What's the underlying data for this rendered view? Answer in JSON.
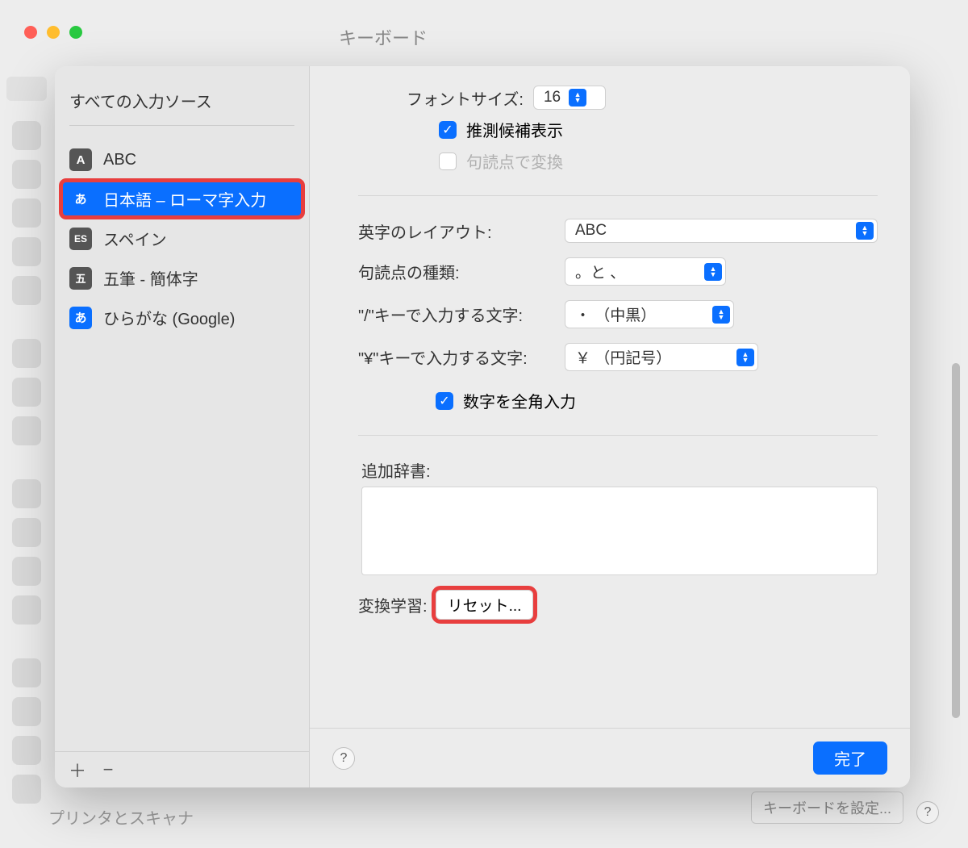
{
  "window": {
    "title": "キーボード"
  },
  "bg": {
    "bottom_text": "プリンタとスキャナ",
    "right_button": "キーボードを設定...",
    "help": "?"
  },
  "sidebar": {
    "header": "すべての入力ソース",
    "items": [
      {
        "icon": "A",
        "icon_class": "a",
        "label": "ABC"
      },
      {
        "icon": "あ",
        "icon_class": "hira",
        "label": "日本語 – ローマ字入力",
        "selected": true,
        "highlighted": true
      },
      {
        "icon": "ES",
        "icon_class": "es",
        "label": "スペイン"
      },
      {
        "icon": "五",
        "icon_class": "wu",
        "label": "五筆 - 簡体字"
      },
      {
        "icon": "あ",
        "icon_class": "hira2",
        "label": "ひらがな (Google)"
      }
    ],
    "add": "＋",
    "remove": "−"
  },
  "settings": {
    "font_size_label": "フォントサイズ:",
    "font_size_value": "16",
    "predict_label": "推測候補表示",
    "punct_convert_label": "句読点で変換",
    "romaji_layout_label": "英字のレイアウト:",
    "romaji_layout_value": "ABC",
    "punct_type_label": "句読点の種類:",
    "punct_type_value": "。と 、",
    "slash_label": "\"/\"キーで入力する文字:",
    "slash_value": "・ （中黒）",
    "yen_label": "\"¥\"キーで入力する文字:",
    "yen_value": "￥ （円記号）",
    "fullwidth_num_label": "数字を全角入力",
    "dict_label": "追加辞書:",
    "learn_label": "変換学習:",
    "reset_button": "リセット..."
  },
  "footer": {
    "help": "?",
    "done": "完了"
  }
}
